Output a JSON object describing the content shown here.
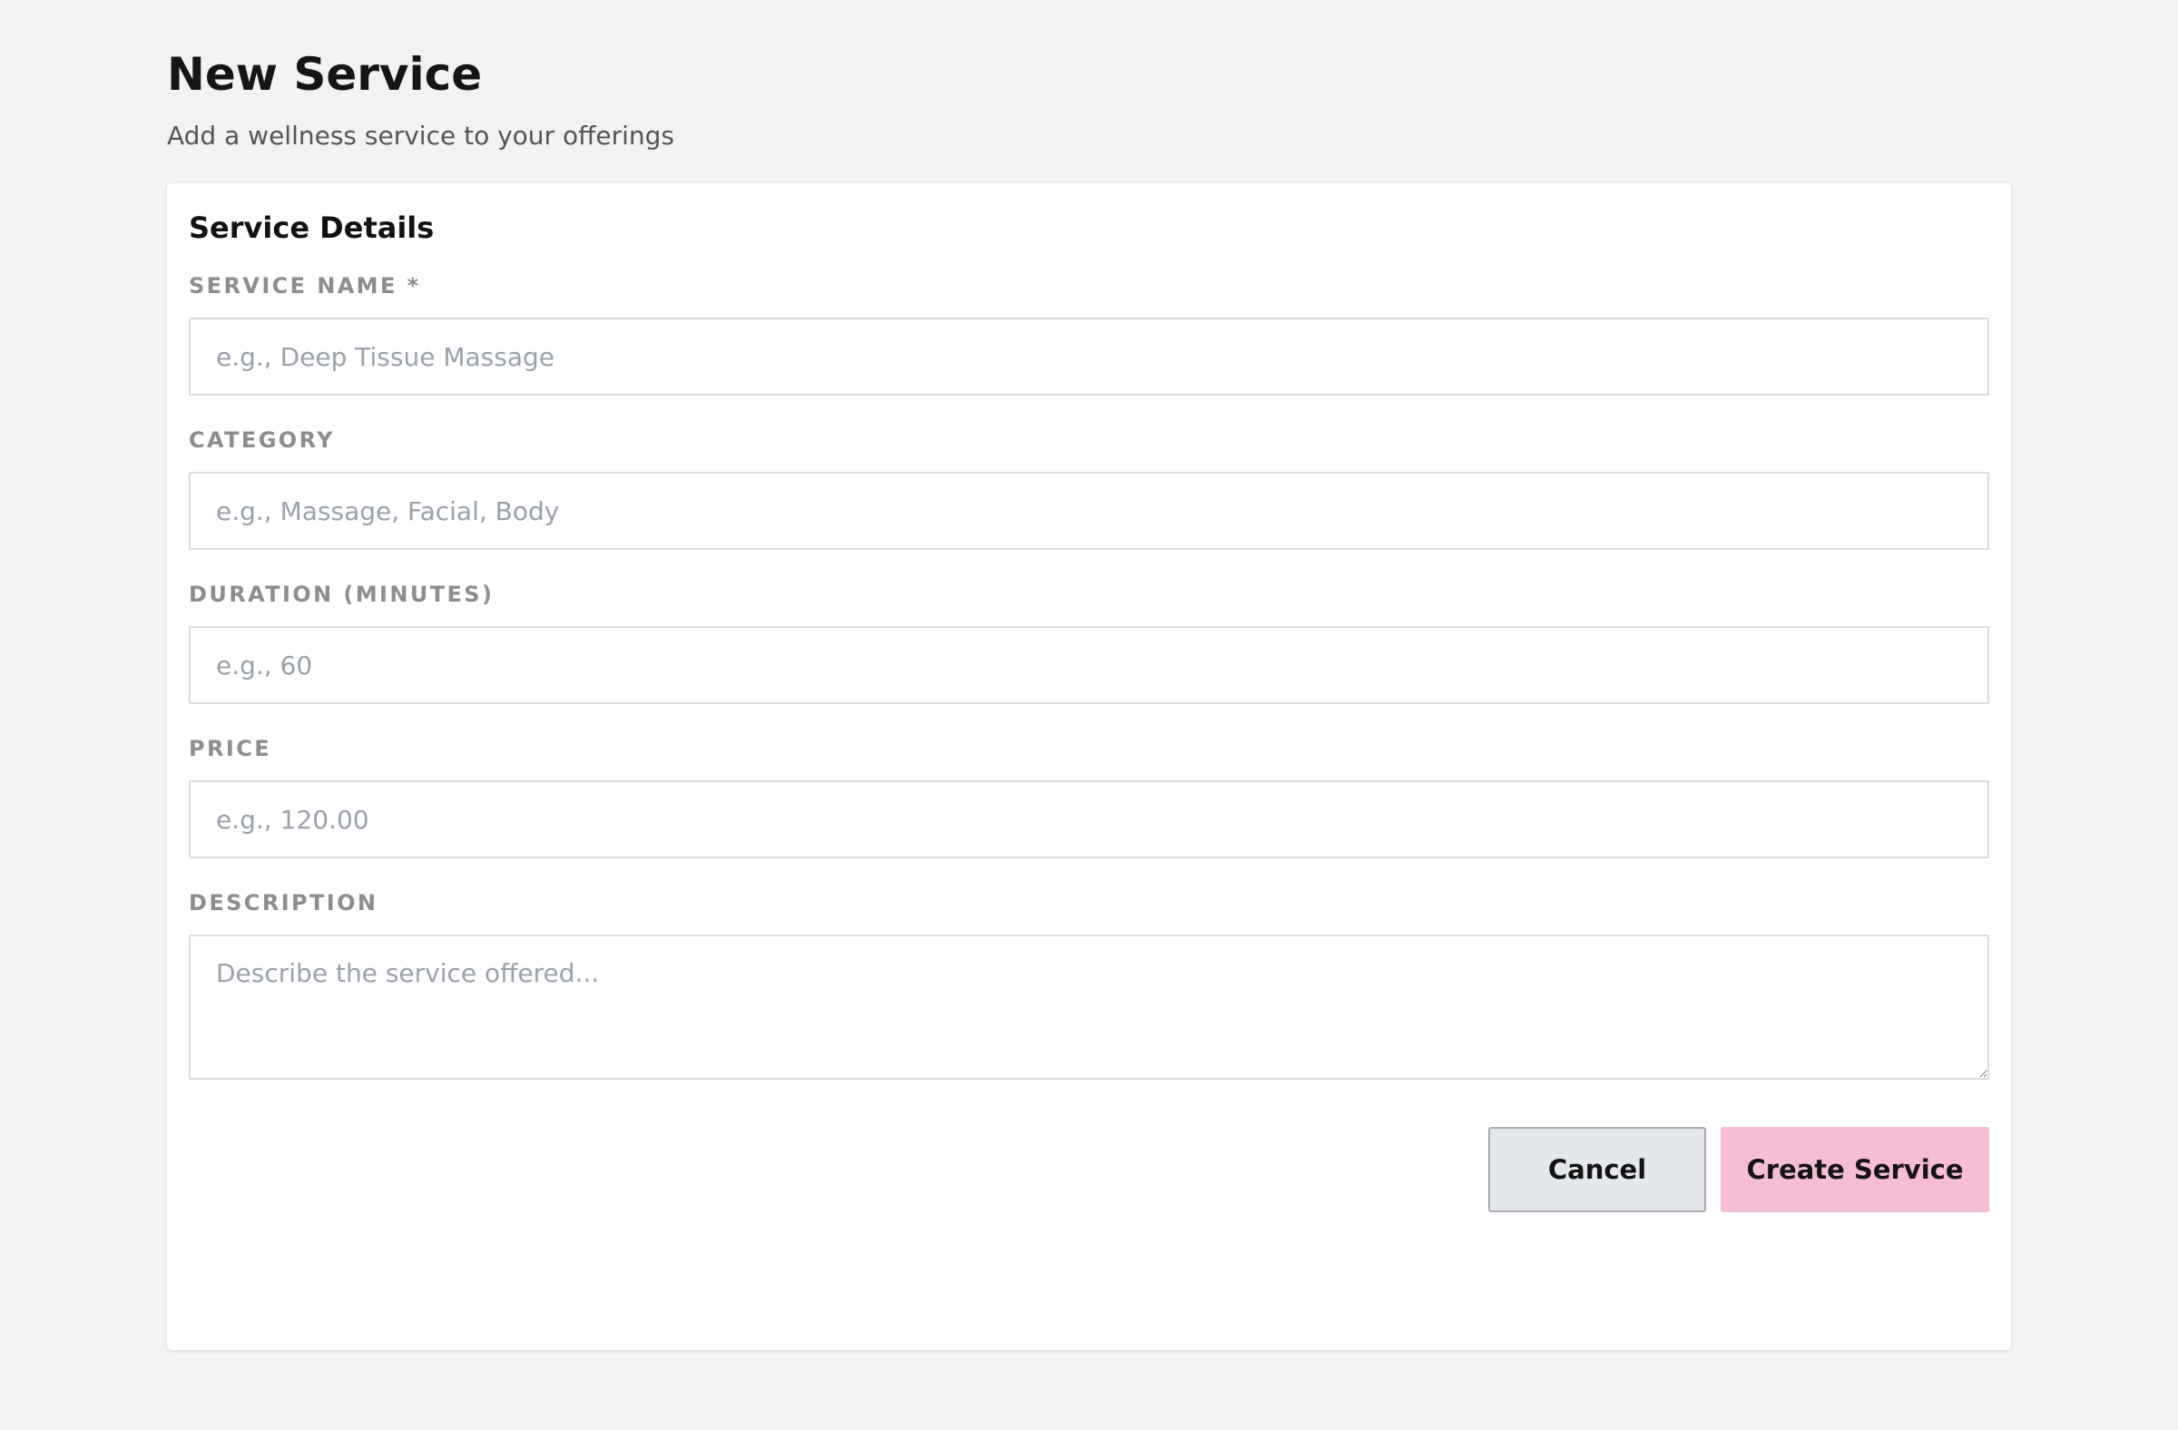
{
  "header": {
    "title": "New Service",
    "subtitle": "Add a wellness service to your offerings"
  },
  "form": {
    "section_title": "Service Details",
    "fields": {
      "service_name": {
        "label": "SERVICE NAME *",
        "placeholder": "e.g., Deep Tissue Massage",
        "value": ""
      },
      "category": {
        "label": "CATEGORY",
        "placeholder": "e.g., Massage, Facial, Body",
        "value": ""
      },
      "duration": {
        "label": "DURATION (MINUTES)",
        "placeholder": "e.g., 60",
        "value": ""
      },
      "price": {
        "label": "PRICE",
        "placeholder": "e.g., 120.00",
        "value": ""
      },
      "description": {
        "label": "DESCRIPTION",
        "placeholder": "Describe the service offered...",
        "value": ""
      }
    },
    "actions": {
      "cancel_label": "Cancel",
      "create_label": "Create Service"
    }
  },
  "colors": {
    "page_background": "#f2f2f2",
    "card_background": "#ffffff",
    "primary_button": "#f5bdd6",
    "secondary_button": "#e4e7eb",
    "label_text": "#8d8d8d",
    "placeholder_text": "#9aa1ab"
  }
}
